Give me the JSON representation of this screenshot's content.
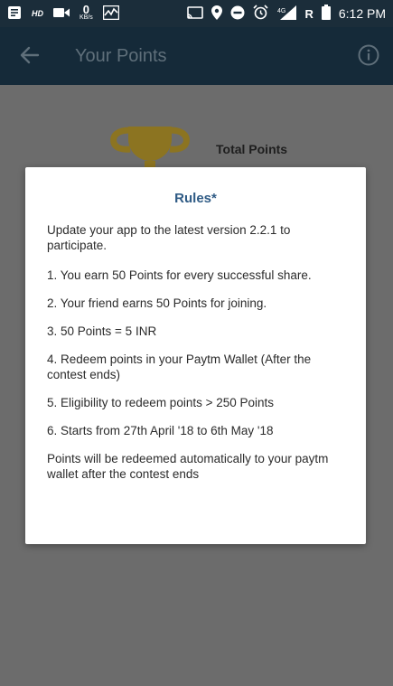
{
  "status_bar": {
    "hd": "HD",
    "speed_value": "0",
    "speed_unit": "KB/s",
    "network": "4G",
    "roaming": "R",
    "time": "6:12 PM"
  },
  "app_bar": {
    "title": "Your Points"
  },
  "background": {
    "total_points_label": "Total Points"
  },
  "dialog": {
    "title": "Rules*",
    "intro": "Update your app to the latest version 2.2.1 to participate.",
    "rules": [
      "1. You earn 50 Points for every successful share.",
      "2. Your friend earns 50 Points for joining.",
      "3. 50 Points = 5 INR",
      "4. Redeem points in your Paytm Wallet (After the contest ends)",
      "5. Eligibility to redeem points > 250 Points",
      "6. Starts from 27th April '18 to 6th May '18"
    ],
    "outro": "Points will be redeemed automatically to your paytm wallet after the contest ends"
  }
}
